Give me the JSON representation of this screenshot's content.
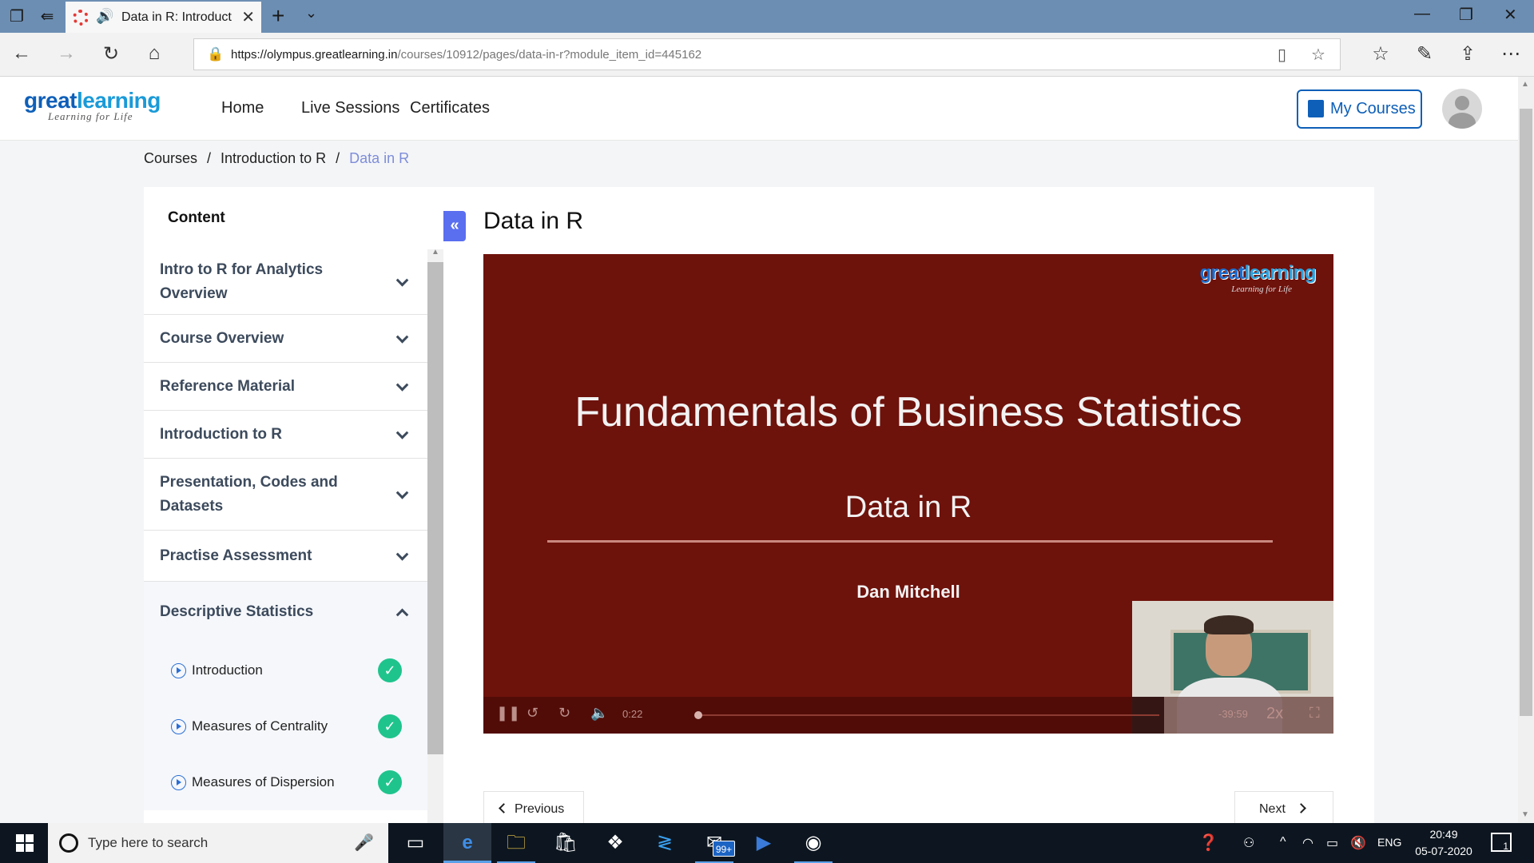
{
  "browser": {
    "tab_title": "Data in R: Introduct",
    "url_domain": "https://olympus.greatlearning.in",
    "url_path": "/courses/10912/pages/data-in-r?module_item_id=445162"
  },
  "site": {
    "logo_great": "great",
    "logo_learning": "learning",
    "logo_tagline": "Learning for Life",
    "nav": [
      "Home",
      "Live Sessions",
      "Certificates"
    ],
    "my_courses_label": "My Courses"
  },
  "breadcrumb": {
    "courses": "Courses",
    "course": "Introduction to R",
    "current": "Data in R",
    "separator": "/"
  },
  "sidebar": {
    "title": "Content",
    "items": [
      {
        "label": "Intro to R for Analytics Overview"
      },
      {
        "label": "Course Overview"
      },
      {
        "label": "Reference Material"
      },
      {
        "label": "Introduction to R"
      },
      {
        "label": "Presentation, Codes and Datasets"
      },
      {
        "label": "Practise Assessment"
      },
      {
        "label": "Descriptive Statistics"
      }
    ],
    "subitems": [
      {
        "label": "Introduction",
        "completed": true
      },
      {
        "label": "Measures of Centrality",
        "completed": true
      },
      {
        "label": "Measures of Dispersion",
        "completed": true
      }
    ]
  },
  "main": {
    "title": "Data in R",
    "video": {
      "logo_great": "great",
      "logo_learning": "learning",
      "logo_tagline": "Learning for Life",
      "slide_title": "Fundamentals of Business Statistics",
      "slide_subtitle": "Data in R",
      "author": "Dan Mitchell",
      "elapsed": "0:22",
      "remaining": "-39:59",
      "speed": "2x",
      "progress_fraction": 0.005
    },
    "prev_label": "Previous",
    "next_label": "Next"
  },
  "taskbar": {
    "search_placeholder": "Type here to search",
    "mail_badge": "99+",
    "language": "ENG",
    "time": "20:49",
    "date": "05-07-2020",
    "notification_count": "1"
  }
}
